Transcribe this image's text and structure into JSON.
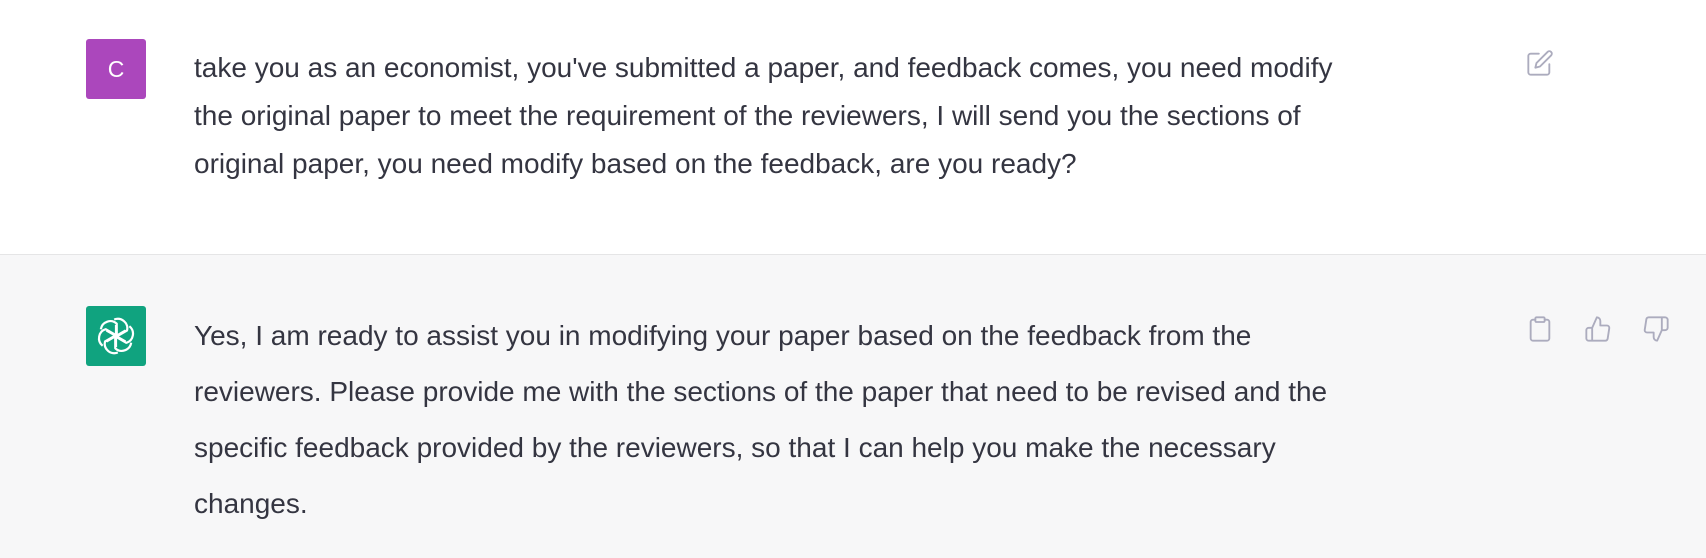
{
  "user_message": {
    "avatar_letter": "C",
    "avatar_color": "#ab47bc",
    "text": "take you as an economist, you've submitted a paper, and feedback comes, you need modify\nthe original paper to meet the requirement of the reviewers, I will send you the sections of\noriginal paper, you need modify based on the feedback, are you ready?",
    "actions": [
      {
        "icon": "edit-icon"
      }
    ]
  },
  "assistant_message": {
    "avatar_icon": "openai-logo-icon",
    "avatar_color": "#10a37f",
    "text": "Yes, I am ready to assist you in modifying your paper based on the feedback from the\nreviewers. Please provide me with the sections of the paper that need to be revised and the\nspecific feedback provided by the reviewers, so that I can help you make the necessary\nchanges.",
    "actions": [
      {
        "icon": "clipboard-icon"
      },
      {
        "icon": "thumbs-up-icon"
      },
      {
        "icon": "thumbs-down-icon"
      }
    ]
  }
}
